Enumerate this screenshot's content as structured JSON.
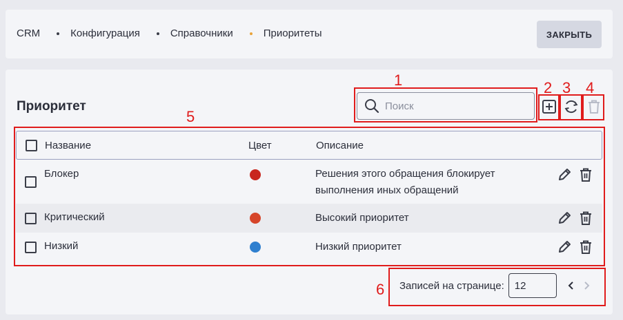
{
  "breadcrumbs": [
    "CRM",
    "Конфигурация",
    "Справочники",
    "Приоритеты"
  ],
  "close_label": "ЗАКРЫТЬ",
  "section_title": "Приоритет",
  "search": {
    "placeholder": "Поиск"
  },
  "annotations": [
    "1",
    "2",
    "3",
    "4",
    "5",
    "6"
  ],
  "table": {
    "headers": {
      "name": "Название",
      "color": "Цвет",
      "description": "Описание"
    },
    "rows": [
      {
        "name": "Блокер",
        "color": "#c8261e",
        "description_line1": "Решения этого обращения блокирует",
        "description_line2": "выполнения иных обращений"
      },
      {
        "name": "Критический",
        "color": "#d6452a",
        "description_line1": "Высокий приоритет"
      },
      {
        "name": "Низкий",
        "color": "#2f7fcf",
        "description_line1": "Низкий приоритет"
      }
    ]
  },
  "pagination": {
    "label": "Записей на странице:",
    "per_page": "12"
  },
  "icons": [
    "search-icon",
    "add-icon",
    "refresh-icon",
    "delete-icon",
    "edit-icon",
    "chevron-left-icon",
    "chevron-right-icon"
  ],
  "colors": {
    "annotation": "#e01b1b",
    "breadcrumb_accent": "#e8a33b"
  }
}
